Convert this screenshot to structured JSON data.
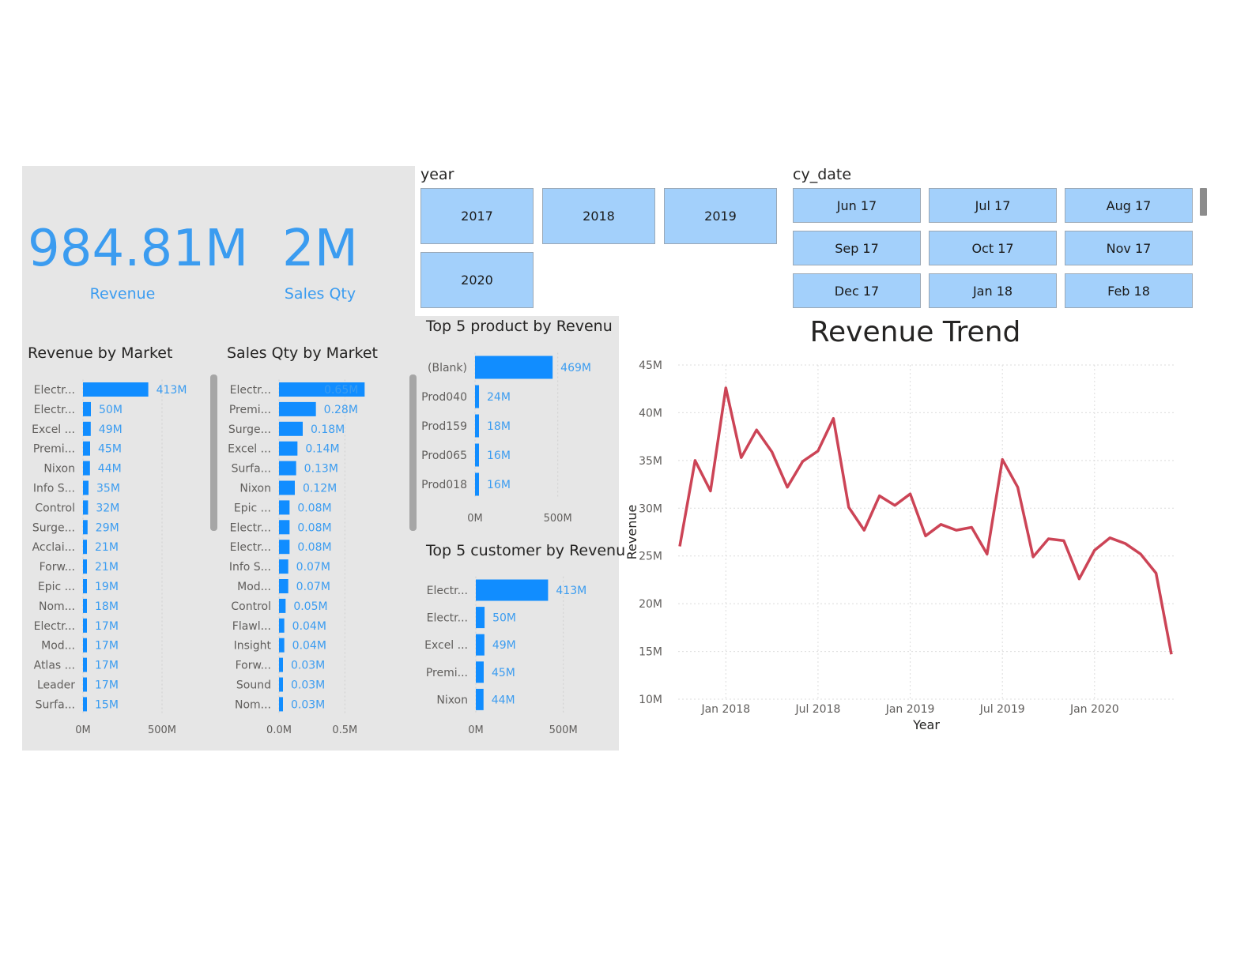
{
  "kpis": {
    "revenue": {
      "value": "984.81M",
      "label": "Revenue"
    },
    "sales_qty": {
      "value": "2M",
      "label": "Sales Qty"
    }
  },
  "slicers": {
    "year": {
      "title": "year",
      "options": [
        "2017",
        "2018",
        "2019",
        "2020"
      ]
    },
    "cy_date": {
      "title": "cy_date",
      "options": [
        "Jun 17",
        "Jul 17",
        "Aug 17",
        "Sep 17",
        "Oct 17",
        "Nov 17",
        "Dec 17",
        "Jan 18",
        "Feb 18"
      ]
    }
  },
  "colors": {
    "panel_bg": "#e6e6e6",
    "bar": "#118dff",
    "label": "#3b9cf0",
    "line": "#cc4456",
    "slicer": "#a3d0fb"
  },
  "chart_data": [
    {
      "id": "revenue_by_market",
      "type": "bar",
      "orientation": "horizontal",
      "title": "Revenue by Market",
      "categories": [
        "Electr...",
        "Electr...",
        "Excel ...",
        "Premi...",
        "Nixon",
        "Info S...",
        "Control",
        "Surge...",
        "Acclai...",
        "Forw...",
        "Epic ...",
        "Nom...",
        "Electr...",
        "Mod...",
        "Atlas ...",
        "Leader",
        "Surfa..."
      ],
      "values": [
        413,
        50,
        49,
        45,
        44,
        35,
        32,
        29,
        21,
        21,
        19,
        18,
        17,
        17,
        17,
        17,
        15
      ],
      "data_labels": [
        "413M",
        "50M",
        "49M",
        "45M",
        "44M",
        "35M",
        "32M",
        "29M",
        "21M",
        "21M",
        "19M",
        "18M",
        "17M",
        "17M",
        "17M",
        "17M",
        "15M"
      ],
      "xticks": [
        0,
        500
      ],
      "xtick_labels": [
        "0M",
        "500M"
      ],
      "xlim": [
        0,
        650
      ],
      "units": "M"
    },
    {
      "id": "sales_qty_by_market",
      "type": "bar",
      "orientation": "horizontal",
      "title": "Sales Qty by Market",
      "categories": [
        "Electr...",
        "Premi...",
        "Surge...",
        "Excel ...",
        "Surfa...",
        "Nixon",
        "Epic ...",
        "Electr...",
        "Electr...",
        "Info S...",
        "Mod...",
        "Control",
        "Flawl...",
        "Insight",
        "Forw...",
        "Sound",
        "Nom..."
      ],
      "values": [
        0.65,
        0.28,
        0.18,
        0.14,
        0.13,
        0.12,
        0.08,
        0.08,
        0.08,
        0.07,
        0.07,
        0.05,
        0.04,
        0.04,
        0.03,
        0.03,
        0.03
      ],
      "data_labels": [
        "0.65M",
        "0.28M",
        "0.18M",
        "0.14M",
        "0.13M",
        "0.12M",
        "0.08M",
        "0.08M",
        "0.08M",
        "0.07M",
        "0.07M",
        "0.05M",
        "0.04M",
        "0.04M",
        "0.03M",
        "0.03M",
        "0.03M"
      ],
      "xticks": [
        0,
        0.5
      ],
      "xtick_labels": [
        "0.0M",
        "0.5M"
      ],
      "xlim": [
        0,
        0.9
      ],
      "units": "M"
    },
    {
      "id": "top5_product",
      "type": "bar",
      "orientation": "horizontal",
      "title": "Top 5 product by Revenu",
      "categories": [
        "(Blank)",
        "Prod040",
        "Prod159",
        "Prod065",
        "Prod018"
      ],
      "values": [
        469,
        24,
        18,
        16,
        16
      ],
      "data_labels": [
        "469M",
        "24M",
        "18M",
        "16M",
        "16M"
      ],
      "xticks": [
        0,
        500
      ],
      "xtick_labels": [
        "0M",
        "500M"
      ],
      "xlim": [
        0,
        750
      ],
      "units": "M"
    },
    {
      "id": "top5_customer",
      "type": "bar",
      "orientation": "horizontal",
      "title": "Top 5 customer by Revenu",
      "categories": [
        "Electr...",
        "Electr...",
        "Excel ...",
        "Premi...",
        "Nixon"
      ],
      "values": [
        413,
        50,
        49,
        45,
        44
      ],
      "data_labels": [
        "413M",
        "50M",
        "49M",
        "45M",
        "44M"
      ],
      "xticks": [
        0,
        500
      ],
      "xtick_labels": [
        "0M",
        "500M"
      ],
      "xlim": [
        0,
        750
      ],
      "units": "M"
    },
    {
      "id": "revenue_trend",
      "type": "line",
      "title": "Revenue Trend",
      "xlabel": "Year",
      "ylabel": "Revenue",
      "x": [
        "2017-10",
        "2017-11",
        "2017-12",
        "2018-01",
        "2018-02",
        "2018-03",
        "2018-04",
        "2018-05",
        "2018-06",
        "2018-07",
        "2018-08",
        "2018-09",
        "2018-10",
        "2018-11",
        "2018-12",
        "2019-01",
        "2019-02",
        "2019-03",
        "2019-04",
        "2019-05",
        "2019-06",
        "2019-07",
        "2019-08",
        "2019-09",
        "2019-10",
        "2019-11",
        "2019-12",
        "2020-01",
        "2020-02",
        "2020-03",
        "2020-04",
        "2020-05",
        "2020-06"
      ],
      "values": [
        26.0,
        35.0,
        31.8,
        42.6,
        35.3,
        38.2,
        35.9,
        32.2,
        34.9,
        36.0,
        39.4,
        30.1,
        27.7,
        31.3,
        30.3,
        31.5,
        27.1,
        28.3,
        27.7,
        28.0,
        25.2,
        35.1,
        32.2,
        24.9,
        26.8,
        26.6,
        22.6,
        25.6,
        26.9,
        26.3,
        25.2,
        23.2,
        14.7
      ],
      "xticks": [
        "2018-01",
        "2018-07",
        "2019-01",
        "2019-07",
        "2020-01"
      ],
      "xtick_labels": [
        "Jan 2018",
        "Jul 2018",
        "Jan 2019",
        "Jul 2019",
        "Jan 2020"
      ],
      "yticks": [
        10,
        15,
        20,
        25,
        30,
        35,
        40,
        45
      ],
      "ytick_labels": [
        "10M",
        "15M",
        "20M",
        "25M",
        "30M",
        "35M",
        "40M",
        "45M"
      ],
      "ylim": [
        10,
        45
      ],
      "grid": true,
      "units": "M"
    }
  ]
}
